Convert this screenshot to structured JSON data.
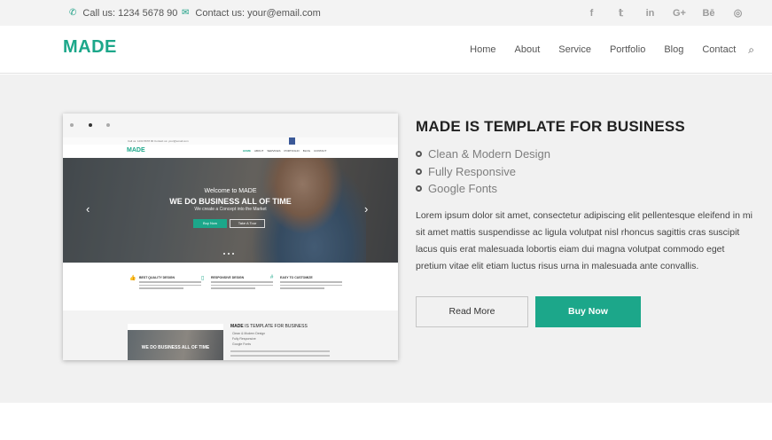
{
  "topbar": {
    "phone": "Call us: 1234 5678 90",
    "email": "Contact us: your@email.com",
    "social": [
      {
        "icon": "facebook-icon",
        "glyph": "f"
      },
      {
        "icon": "twitter-icon",
        "glyph": "𝕥"
      },
      {
        "icon": "linkedin-icon",
        "glyph": "in"
      },
      {
        "icon": "googleplus-icon",
        "glyph": "G+"
      },
      {
        "icon": "behance-icon",
        "glyph": "Bē"
      },
      {
        "icon": "dribbble-icon",
        "glyph": "◎"
      }
    ]
  },
  "header": {
    "logo": "MADE",
    "nav": [
      "Home",
      "About",
      "Service",
      "Portfolio",
      "Blog",
      "Contact"
    ],
    "search_icon": "⌕"
  },
  "preview": {
    "mini_topbar": "Call us: 1234 5678 90      Contact us: your@email.com",
    "mini_logo": "MADE",
    "mini_nav": [
      "HOME",
      "ABOUT",
      "SERVICES",
      "PORTFOLIO",
      "BLOG",
      "CONTACT"
    ],
    "welcome": "Welcome to MADE",
    "hero_title": "WE DO BUSINESS ALL OF TIME",
    "hero_sub": "We create a Concept into the Market",
    "btn_buy": "Buy Now",
    "btn_tour": "Take A Tour",
    "features": [
      {
        "title": "BEST QUALITY DESIGN"
      },
      {
        "title": "RESPONSIVE DESIGN"
      },
      {
        "title": "EASY TO CUSTOMIZE"
      }
    ],
    "section_title_bold": "MADE",
    "section_title_rest": " IS TEMPLATE FOR BUSINESS",
    "section_list": [
      "Clean & Modern Design",
      "Fully Responsive",
      "Google Fonts"
    ],
    "section_img_caption": "WE DO BUSINESS ALL OF TIME"
  },
  "content": {
    "title": "MADE IS TEMPLATE FOR BUSINESS",
    "features": [
      "Clean & Modern Design",
      "Fully Responsive",
      "Google Fonts"
    ],
    "description": "Lorem ipsum dolor sit amet, consectetur adipiscing elit pellentesque eleifend in mi sit amet mattis suspendisse ac ligula volutpat nisl rhoncus sagittis cras suscipit lacus quis erat malesuada lobortis eiam dui magna volutpat commodo eget pretium vitae elit etiam luctus risus urna in malesuada ante convallis.",
    "read_more": "Read More",
    "buy_now": "Buy Now"
  },
  "colors": {
    "accent": "#1ca78a",
    "topbar_bg": "#f3f3f3",
    "hero_bg": "#f1f1f1"
  }
}
